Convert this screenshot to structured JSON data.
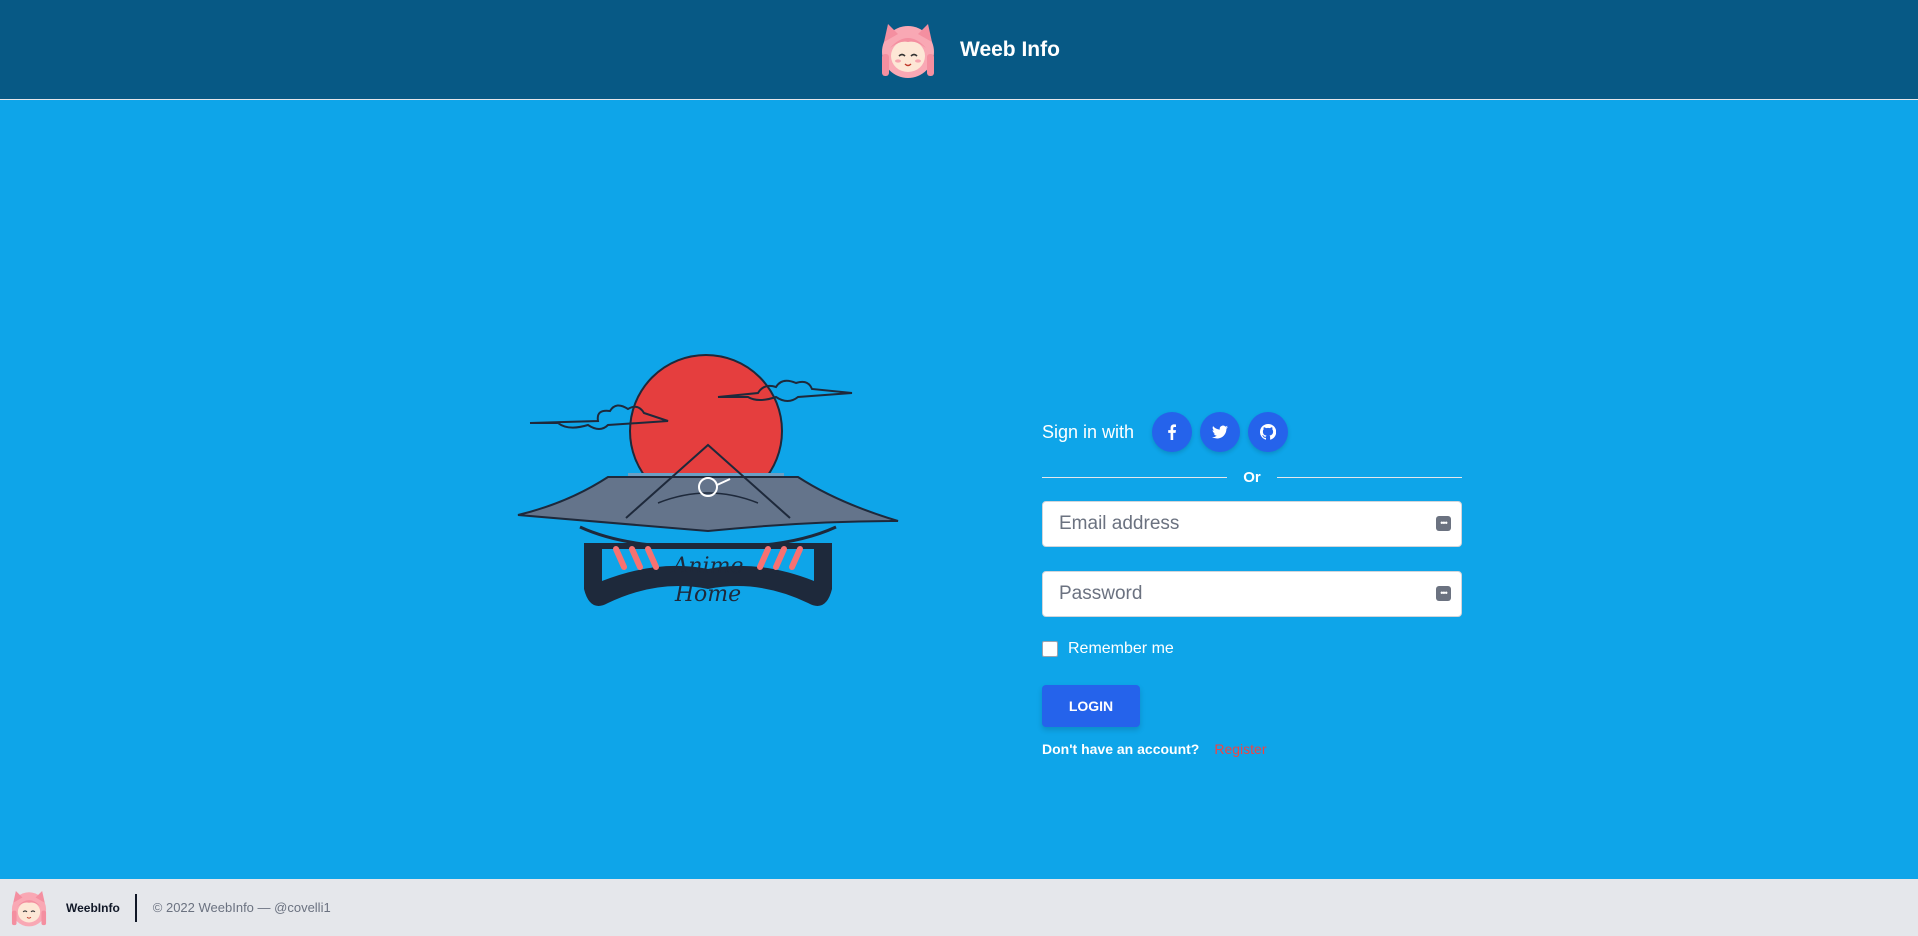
{
  "header": {
    "title": "Weeb Info",
    "avatar_icon": "anime-girl-avatar-icon"
  },
  "hero": {
    "logo_text_line1": "Anime",
    "logo_text_line2": "Home",
    "colors": {
      "sun": "#e53e3e",
      "roof": "#64748b",
      "ink": "#1e293b"
    }
  },
  "signin": {
    "label": "Sign in with",
    "providers": [
      {
        "name": "facebook",
        "icon": "facebook-icon"
      },
      {
        "name": "twitter",
        "icon": "twitter-icon"
      },
      {
        "name": "github",
        "icon": "github-icon"
      }
    ],
    "divider_text": "Or"
  },
  "form": {
    "email_placeholder": "Email address",
    "email_value": "",
    "password_placeholder": "Password",
    "password_value": "",
    "remember_label": "Remember me",
    "remember_checked": false,
    "login_label": "LOGIN",
    "register_question": "Don't have an account?",
    "register_link": "Register"
  },
  "footer": {
    "brand": "WeebInfo",
    "copyright": "© 2022 WeebInfo — @covelli1"
  },
  "colors": {
    "page_bg": "#0ea5e9",
    "header_bg": "#075985",
    "footer_bg": "#e5e7eb",
    "primary": "#2563eb",
    "register_link": "#ef4444"
  }
}
